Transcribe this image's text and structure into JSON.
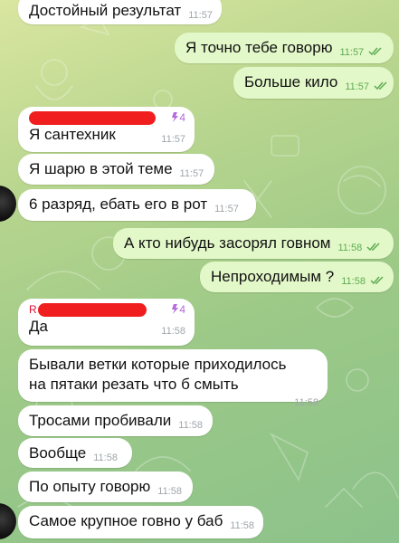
{
  "colors": {
    "incoming_bubble": "#ffffff",
    "outgoing_bubble": "#e3f8c9",
    "read_ticks": "#5fab52",
    "redaction": "#f01e1e",
    "boost_badge": "#b36bd9"
  },
  "messages": [
    {
      "dir": "in",
      "text": "Достойный результат",
      "time": "11:57"
    },
    {
      "dir": "out",
      "text": "Я точно тебе говорю",
      "time": "11:57",
      "read": true
    },
    {
      "dir": "out",
      "text": "Больше кило",
      "time": "11:57",
      "read": true
    },
    {
      "dir": "in",
      "sender_redacted": true,
      "boost": "4",
      "text": "Я сантехник",
      "time": "11:57"
    },
    {
      "dir": "in",
      "text": "Я шарю в этой теме",
      "time": "11:57"
    },
    {
      "dir": "in",
      "text": "6 разряд, ебать его в рот",
      "time": "11:57"
    },
    {
      "dir": "out",
      "text": "А кто нибудь засорял говном",
      "time": "11:58",
      "read": true
    },
    {
      "dir": "out",
      "text": "Непроходимым ?",
      "time": "11:58",
      "read": true
    },
    {
      "dir": "in",
      "sender_redacted": true,
      "sender_initial": "R",
      "boost": "4",
      "text": "Да",
      "time": "11:58"
    },
    {
      "dir": "in",
      "text": "Бывали ветки которые приходилось на пятаки резать что б смыть",
      "time": "11:58"
    },
    {
      "dir": "in",
      "text": "Тросами пробивали",
      "time": "11:58"
    },
    {
      "dir": "in",
      "text": "Вообще",
      "time": "11:58"
    },
    {
      "dir": "in",
      "text": "По опыту говорю",
      "time": "11:58"
    },
    {
      "dir": "in",
      "text": "Самое крупное говно у баб",
      "time": "11:58"
    }
  ]
}
